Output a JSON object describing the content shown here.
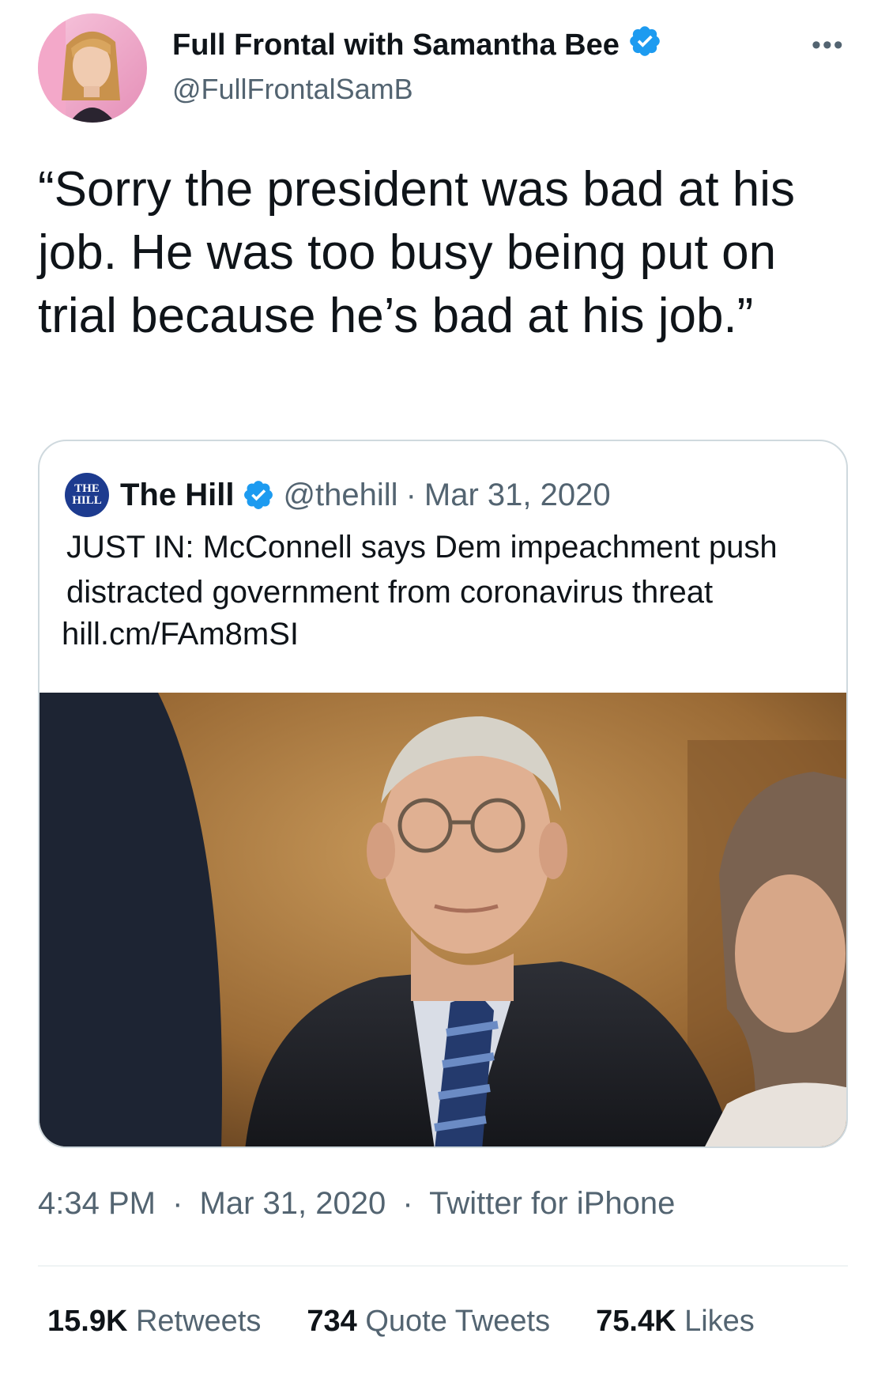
{
  "author": {
    "display_name": "Full Frontal with Samantha Bee",
    "handle": "@FullFrontalSamB",
    "verified": true
  },
  "menu": {
    "more_label": "•••"
  },
  "tweet": {
    "text": "“Sorry the president was bad at his job. He was too busy being put on trial because he’s bad at his job.”"
  },
  "quoted": {
    "logo_text_top": "THE",
    "logo_text_bottom": "HILL",
    "name": "The Hill",
    "handle": "@thehill",
    "separator": "·",
    "date": "Mar 31, 2020",
    "text": "JUST IN: McConnell says Dem impeachment push distracted government from coronavirus threat",
    "link": "hill.cm/FAm8mSI"
  },
  "meta": {
    "time": "4:34 PM",
    "separator": "·",
    "date": "Mar 31, 2020",
    "source": "Twitter for iPhone"
  },
  "stats": {
    "retweets_count": "15.9K",
    "retweets_label": "Retweets",
    "quotes_count": "734",
    "quotes_label": "Quote Tweets",
    "likes_count": "75.4K",
    "likes_label": "Likes"
  },
  "colors": {
    "verified_blue": "#1d9bf0",
    "secondary_text": "#536471",
    "border": "#cfd9de",
    "hill_logo": "#1d3b8f"
  }
}
